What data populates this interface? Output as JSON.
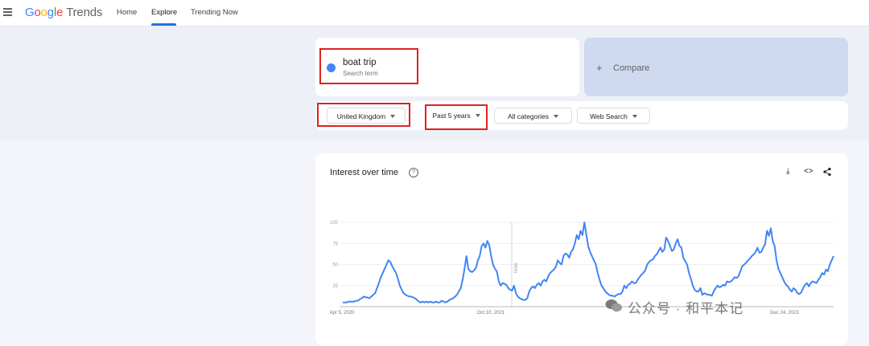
{
  "app": {
    "logo_google": "Google",
    "logo_trends": "Trends"
  },
  "nav": {
    "home": "Home",
    "explore": "Explore",
    "trending": "Trending Now"
  },
  "search_term": {
    "name": "boat trip",
    "type": "Search term",
    "color": "#4285f4"
  },
  "compare": {
    "plus": "+",
    "label": "Compare"
  },
  "filters": {
    "region": "United Kingdom",
    "time": "Past 5 years",
    "category": "All categories",
    "property": "Web Search"
  },
  "chart_card": {
    "title": "Interest over time",
    "help": "?",
    "download": "⤓",
    "embed": "<>",
    "share": "share"
  },
  "chart_data": {
    "type": "line",
    "series": [
      {
        "name": "boat trip",
        "color": "#4285f4"
      }
    ],
    "y_ticks": [
      "100",
      "75",
      "50",
      "25"
    ],
    "ylim": [
      0,
      100
    ],
    "x_labels": [
      "Apr 5, 2020",
      "Oct 10, 2021",
      "Dec 24, 2023"
    ],
    "note_label": "Note",
    "values": [
      5,
      5,
      5,
      6,
      6,
      6,
      6,
      7,
      7,
      9,
      10,
      12,
      11,
      11,
      10,
      12,
      14,
      16,
      22,
      28,
      35,
      40,
      45,
      50,
      55,
      53,
      48,
      44,
      40,
      33,
      25,
      20,
      16,
      14,
      13,
      12,
      12,
      11,
      10,
      8,
      6,
      5,
      6,
      5,
      6,
      5,
      6,
      5,
      5,
      6,
      5,
      5,
      7,
      6,
      5,
      6,
      8,
      9,
      10,
      12,
      14,
      18,
      22,
      32,
      45,
      60,
      45,
      42,
      41,
      43,
      46,
      55,
      60,
      72,
      75,
      70,
      78,
      73,
      60,
      50,
      45,
      42,
      30,
      25,
      28,
      27,
      26,
      22,
      20,
      19,
      25,
      16,
      12,
      10,
      9,
      8,
      8,
      10,
      18,
      22,
      24,
      22,
      26,
      28,
      25,
      30,
      32,
      30,
      36,
      40,
      42,
      44,
      47,
      55,
      52,
      50,
      60,
      63,
      62,
      58,
      65,
      68,
      75,
      85,
      80,
      90,
      85,
      100,
      86,
      72,
      65,
      60,
      55,
      50,
      40,
      32,
      25,
      22,
      18,
      16,
      14,
      13,
      13,
      12,
      14,
      15,
      15,
      18,
      25,
      22,
      26,
      27,
      30,
      28,
      28,
      32,
      35,
      38,
      40,
      43,
      50,
      53,
      55,
      56,
      60,
      62,
      66,
      70,
      65,
      68,
      82,
      78,
      72,
      66,
      68,
      75,
      80,
      72,
      70,
      58,
      54,
      50,
      40,
      33,
      25,
      20,
      18,
      18,
      22,
      14,
      16,
      15,
      14,
      14,
      13,
      18,
      22,
      25,
      23,
      24,
      26,
      25,
      30,
      29,
      30,
      32,
      35,
      34,
      36,
      42,
      48,
      50,
      52,
      55,
      57,
      60,
      62,
      65,
      70,
      64,
      65,
      70,
      74,
      90,
      84,
      93,
      78,
      72,
      55,
      45,
      40,
      35,
      30,
      26,
      24,
      20,
      18,
      22,
      20,
      16,
      15,
      17,
      22,
      26,
      28,
      24,
      28,
      30,
      29,
      28,
      32,
      35,
      40,
      38,
      44,
      42,
      50,
      55,
      60
    ]
  },
  "watermark": "公众号 · 和平本记"
}
